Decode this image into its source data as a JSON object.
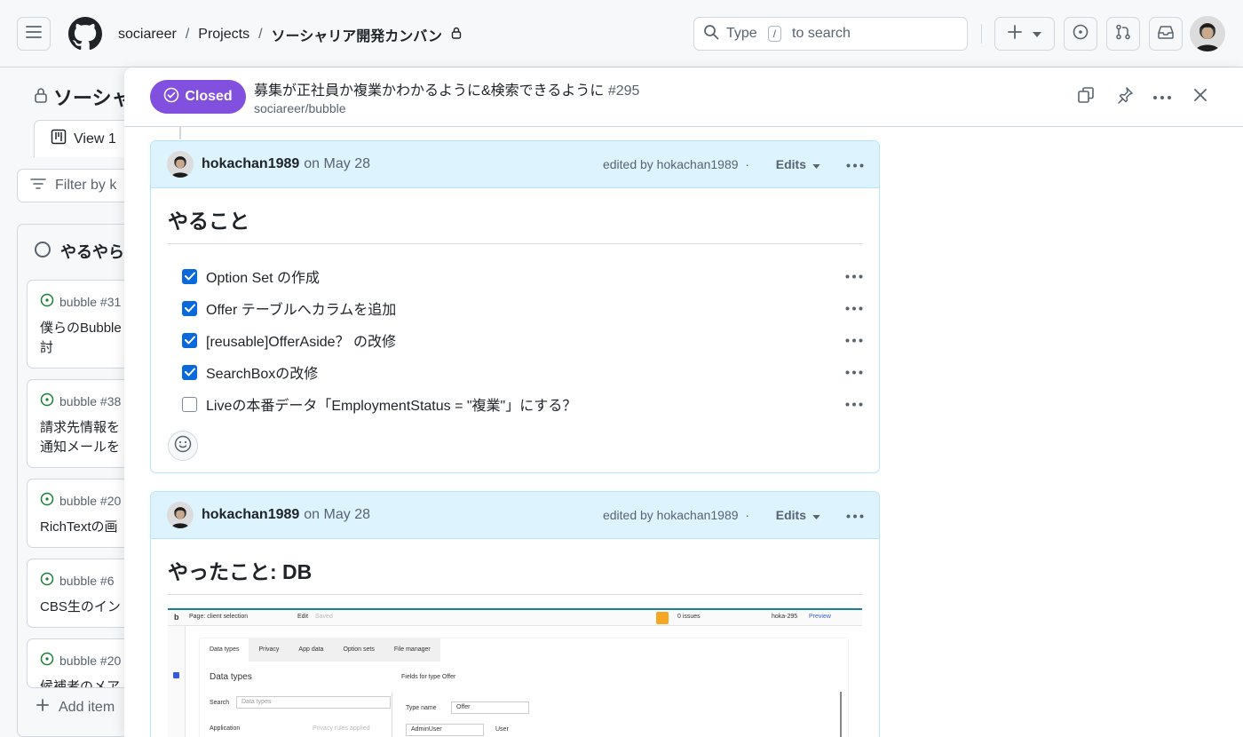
{
  "header": {
    "breadcrumbs": [
      "sociareer",
      "Projects",
      "ソーシャリア開発カンバン"
    ],
    "separator": "/",
    "search_pre": "Type",
    "search_key": "/",
    "search_post": "to search"
  },
  "board": {
    "title": "ソーシャ",
    "view_tab": "View 1",
    "filter_placeholder": "Filter by k",
    "column_title": "やるやら",
    "cards": [
      {
        "meta": "bubble #31",
        "title": "僕らのBubble\n討"
      },
      {
        "meta": "bubble #38",
        "title": "請求先情報を\n通知メールを"
      },
      {
        "meta": "bubble #20",
        "title": "RichTextの画"
      },
      {
        "meta": "bubble #6",
        "title": "CBS生のイン"
      },
      {
        "meta": "bubble #20",
        "title": "候補者のメア"
      }
    ],
    "add_item": "Add item"
  },
  "panel": {
    "status": "Closed",
    "title": "募集が正社員か複業かわかるように&検索できるように",
    "number": "#295",
    "repo": "sociareer/bubble"
  },
  "comments": [
    {
      "author": "hokachan1989",
      "date": "on May 28",
      "edited_by": "edited by hokachan1989",
      "dot": "·",
      "edits_label": "Edits",
      "heading": "やること",
      "tasks": [
        {
          "text": "Option Set の作成",
          "checked": true
        },
        {
          "text": "Offer テーブルへカラムを追加",
          "checked": true
        },
        {
          "text": "[reusable]OfferAside？ の改修",
          "checked": true
        },
        {
          "text": "SearchBoxの改修",
          "checked": true
        },
        {
          "text": "Liveの本番データ「EmploymentStatus = \"複業\"」にする？",
          "checked": false
        }
      ]
    },
    {
      "author": "hokachan1989",
      "date": "on May 28",
      "edited_by": "edited by hokachan1989",
      "dot": "·",
      "edits_label": "Edits",
      "heading": "やったこと: DB"
    }
  ],
  "screenshot": {
    "page_label": "Page: client selection",
    "edit": "Edit",
    "saved": "Saved",
    "issues": "0 issues",
    "branch": "hoka-295",
    "preview": "Preview",
    "tabs": [
      "Data types",
      "Privacy",
      "App data",
      "Option sets",
      "File manager"
    ],
    "data_types_heading": "Data types",
    "search_label": "Search",
    "search_placeholder": "Data types",
    "application": "Application",
    "privacy_rules": "Privacy rules applied",
    "fields_for": "Fields for type Offer",
    "type_name_label": "Type name",
    "type_name_value": "Offer",
    "field_name": "AdminUser",
    "field_type": "User"
  },
  "colors": {
    "closed": "#8250df",
    "accent": "#0969da",
    "comment_header": "#ddf4ff",
    "open_issue": "#1a7f37"
  }
}
